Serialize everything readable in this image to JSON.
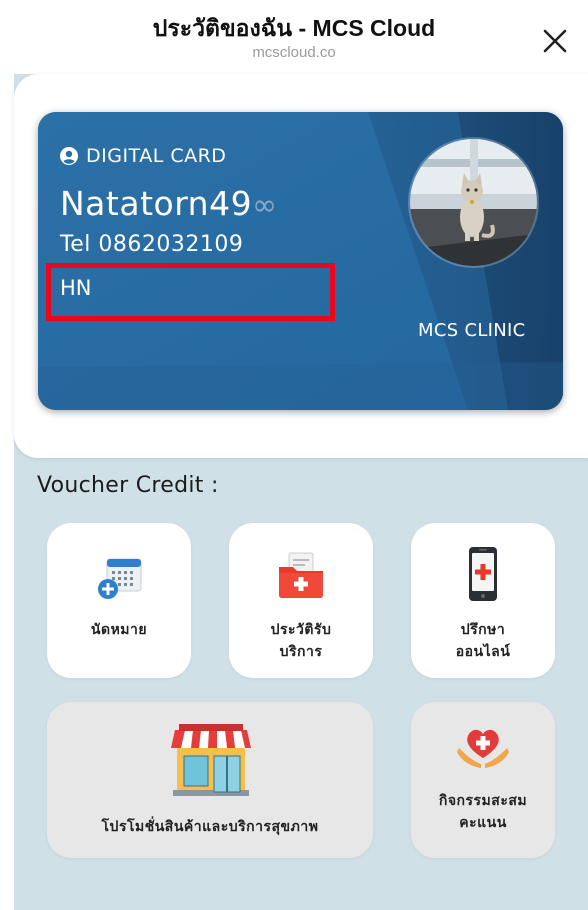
{
  "header": {
    "title": "ประวัติของฉัน - MCS Cloud",
    "domain": "mcscloud.co",
    "close_icon": "close-icon"
  },
  "card": {
    "label": "DIGITAL CARD",
    "name": "Natatorn49",
    "name_suffix": "∞",
    "tel": "Tel 0862032109",
    "hn": "HN",
    "clinic": "MCS CLINIC",
    "colors": {
      "card_blue": "#2a6fa3",
      "card_dark": "#1d4f7d",
      "highlight": "#e8071d"
    }
  },
  "voucher": {
    "title": "Voucher Credit :",
    "tiles": [
      {
        "label_line1": "นัดหมาย",
        "label_line2": "",
        "icon": "calendar-add-icon"
      },
      {
        "label_line1": "ประวัติรับ",
        "label_line2": "บริการ",
        "icon": "medical-folder-icon"
      },
      {
        "label_line1": "ปรึกษา",
        "label_line2": "ออนไลน์",
        "icon": "phone-medical-icon"
      },
      {
        "label_line1": "โปรโมชั่นสินค้าและบริการสุขภาพ",
        "label_line2": "",
        "icon": "shop-icon"
      },
      {
        "label_line1": "กิจกรรมสะสม",
        "label_line2": "คะแนน",
        "icon": "heart-hands-icon"
      }
    ]
  },
  "colors": {
    "background": "#cfe0e6",
    "panel": "#ffffff",
    "tile_grey": "#e7e7e8"
  }
}
